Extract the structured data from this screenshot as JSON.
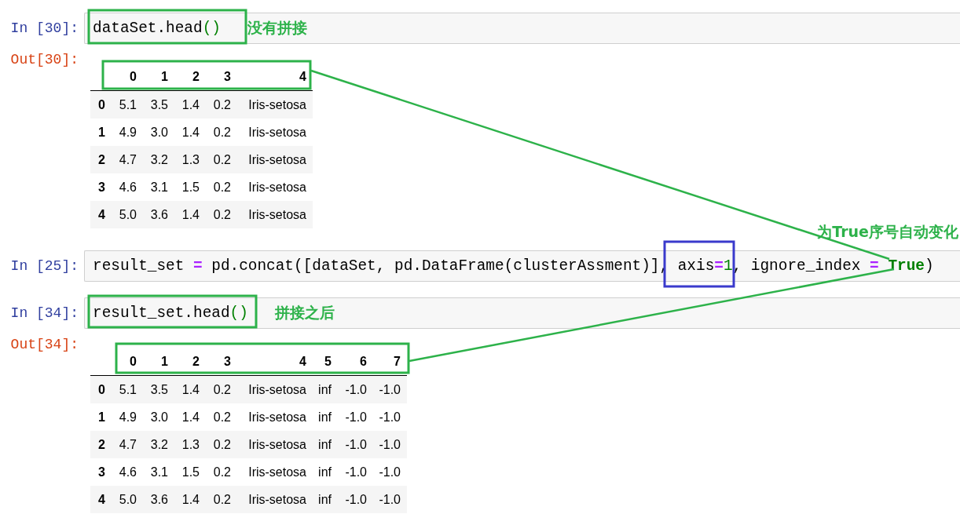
{
  "cells": [
    {
      "kind": "input",
      "prompt": "In [30]:",
      "code": [
        {
          "kind": "text",
          "text": "dataSet.head"
        },
        {
          "kind": "paren",
          "text": "()"
        }
      ],
      "note": "没有拼接"
    },
    {
      "kind": "output",
      "prompt": "Out[30]:",
      "table": {
        "columns": [
          "0",
          "1",
          "2",
          "3",
          "4"
        ],
        "rows": [
          {
            "index": "0",
            "values": [
              "5.1",
              "3.5",
              "1.4",
              "0.2",
              "Iris-setosa"
            ]
          },
          {
            "index": "1",
            "values": [
              "4.9",
              "3.0",
              "1.4",
              "0.2",
              "Iris-setosa"
            ]
          },
          {
            "index": "2",
            "values": [
              "4.7",
              "3.2",
              "1.3",
              "0.2",
              "Iris-setosa"
            ]
          },
          {
            "index": "3",
            "values": [
              "4.6",
              "3.1",
              "1.5",
              "0.2",
              "Iris-setosa"
            ]
          },
          {
            "index": "4",
            "values": [
              "5.0",
              "3.6",
              "1.4",
              "0.2",
              "Iris-setosa"
            ]
          }
        ]
      }
    },
    {
      "kind": "caption",
      "text": "为True序号自动变化"
    },
    {
      "kind": "input",
      "prompt": "In [25]:",
      "code": [
        {
          "kind": "text",
          "text": "result_set "
        },
        {
          "kind": "op",
          "text": "="
        },
        {
          "kind": "text",
          "text": " pd.concat([dataSet, pd.DataFrame(clusterAssment)], axis"
        },
        {
          "kind": "op",
          "text": "="
        },
        {
          "kind": "num",
          "text": "1"
        },
        {
          "kind": "text",
          "text": ", ignore_index "
        },
        {
          "kind": "op",
          "text": "= "
        },
        {
          "kind": "kw",
          "text": "True"
        },
        {
          "kind": "text",
          "text": ")"
        }
      ]
    },
    {
      "kind": "input",
      "prompt": "In [34]:",
      "code": [
        {
          "kind": "text",
          "text": "result_set.head"
        },
        {
          "kind": "paren",
          "text": "()"
        }
      ],
      "note": "拼接之后"
    },
    {
      "kind": "output",
      "prompt": "Out[34]:",
      "table": {
        "columns": [
          "0",
          "1",
          "2",
          "3",
          "4",
          "5",
          "6",
          "7"
        ],
        "rows": [
          {
            "index": "0",
            "values": [
              "5.1",
              "3.5",
              "1.4",
              "0.2",
              "Iris-setosa",
              "inf",
              "-1.0",
              "-1.0"
            ]
          },
          {
            "index": "1",
            "values": [
              "4.9",
              "3.0",
              "1.4",
              "0.2",
              "Iris-setosa",
              "inf",
              "-1.0",
              "-1.0"
            ]
          },
          {
            "index": "2",
            "values": [
              "4.7",
              "3.2",
              "1.3",
              "0.2",
              "Iris-setosa",
              "inf",
              "-1.0",
              "-1.0"
            ]
          },
          {
            "index": "3",
            "values": [
              "4.6",
              "3.1",
              "1.5",
              "0.2",
              "Iris-setosa",
              "inf",
              "-1.0",
              "-1.0"
            ]
          },
          {
            "index": "4",
            "values": [
              "5.0",
              "3.6",
              "1.4",
              "0.2",
              "Iris-setosa",
              "inf",
              "-1.0",
              "-1.0"
            ]
          }
        ]
      }
    }
  ]
}
